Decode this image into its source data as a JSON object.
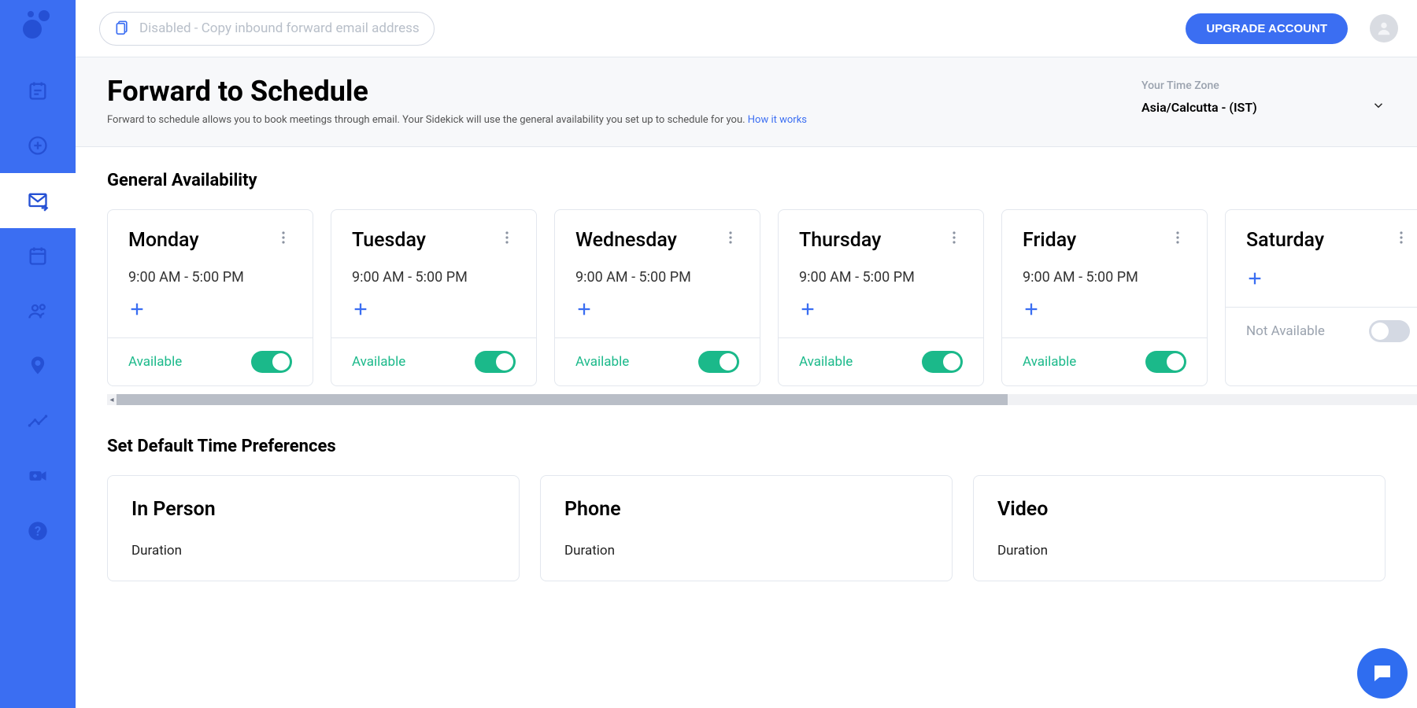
{
  "topbar": {
    "copy_text": "Disabled - Copy inbound forward email address",
    "upgrade_label": "UPGRADE ACCOUNT"
  },
  "header": {
    "title": "Forward to Schedule",
    "description": "Forward to schedule allows you to book meetings through email. Your Sidekick will use the general availability you set up to schedule for you.",
    "how_it_works": "How it works",
    "tz_label": "Your Time Zone",
    "tz_value": "Asia/Calcutta - (IST)"
  },
  "availability": {
    "section_title": "General Availability",
    "days": [
      {
        "name": "Monday",
        "time": "9:00 AM - 5:00 PM",
        "available": true,
        "status_label": "Available"
      },
      {
        "name": "Tuesday",
        "time": "9:00 AM - 5:00 PM",
        "available": true,
        "status_label": "Available"
      },
      {
        "name": "Wednesday",
        "time": "9:00 AM - 5:00 PM",
        "available": true,
        "status_label": "Available"
      },
      {
        "name": "Thursday",
        "time": "9:00 AM - 5:00 PM",
        "available": true,
        "status_label": "Available"
      },
      {
        "name": "Friday",
        "time": "9:00 AM - 5:00 PM",
        "available": true,
        "status_label": "Available"
      },
      {
        "name": "Saturday",
        "time": "",
        "available": false,
        "status_label": "Not Available"
      }
    ]
  },
  "prefs": {
    "section_title": "Set Default Time Preferences",
    "cards": [
      {
        "title": "In Person",
        "duration_label": "Duration"
      },
      {
        "title": "Phone",
        "duration_label": "Duration"
      },
      {
        "title": "Video",
        "duration_label": "Duration"
      }
    ]
  }
}
